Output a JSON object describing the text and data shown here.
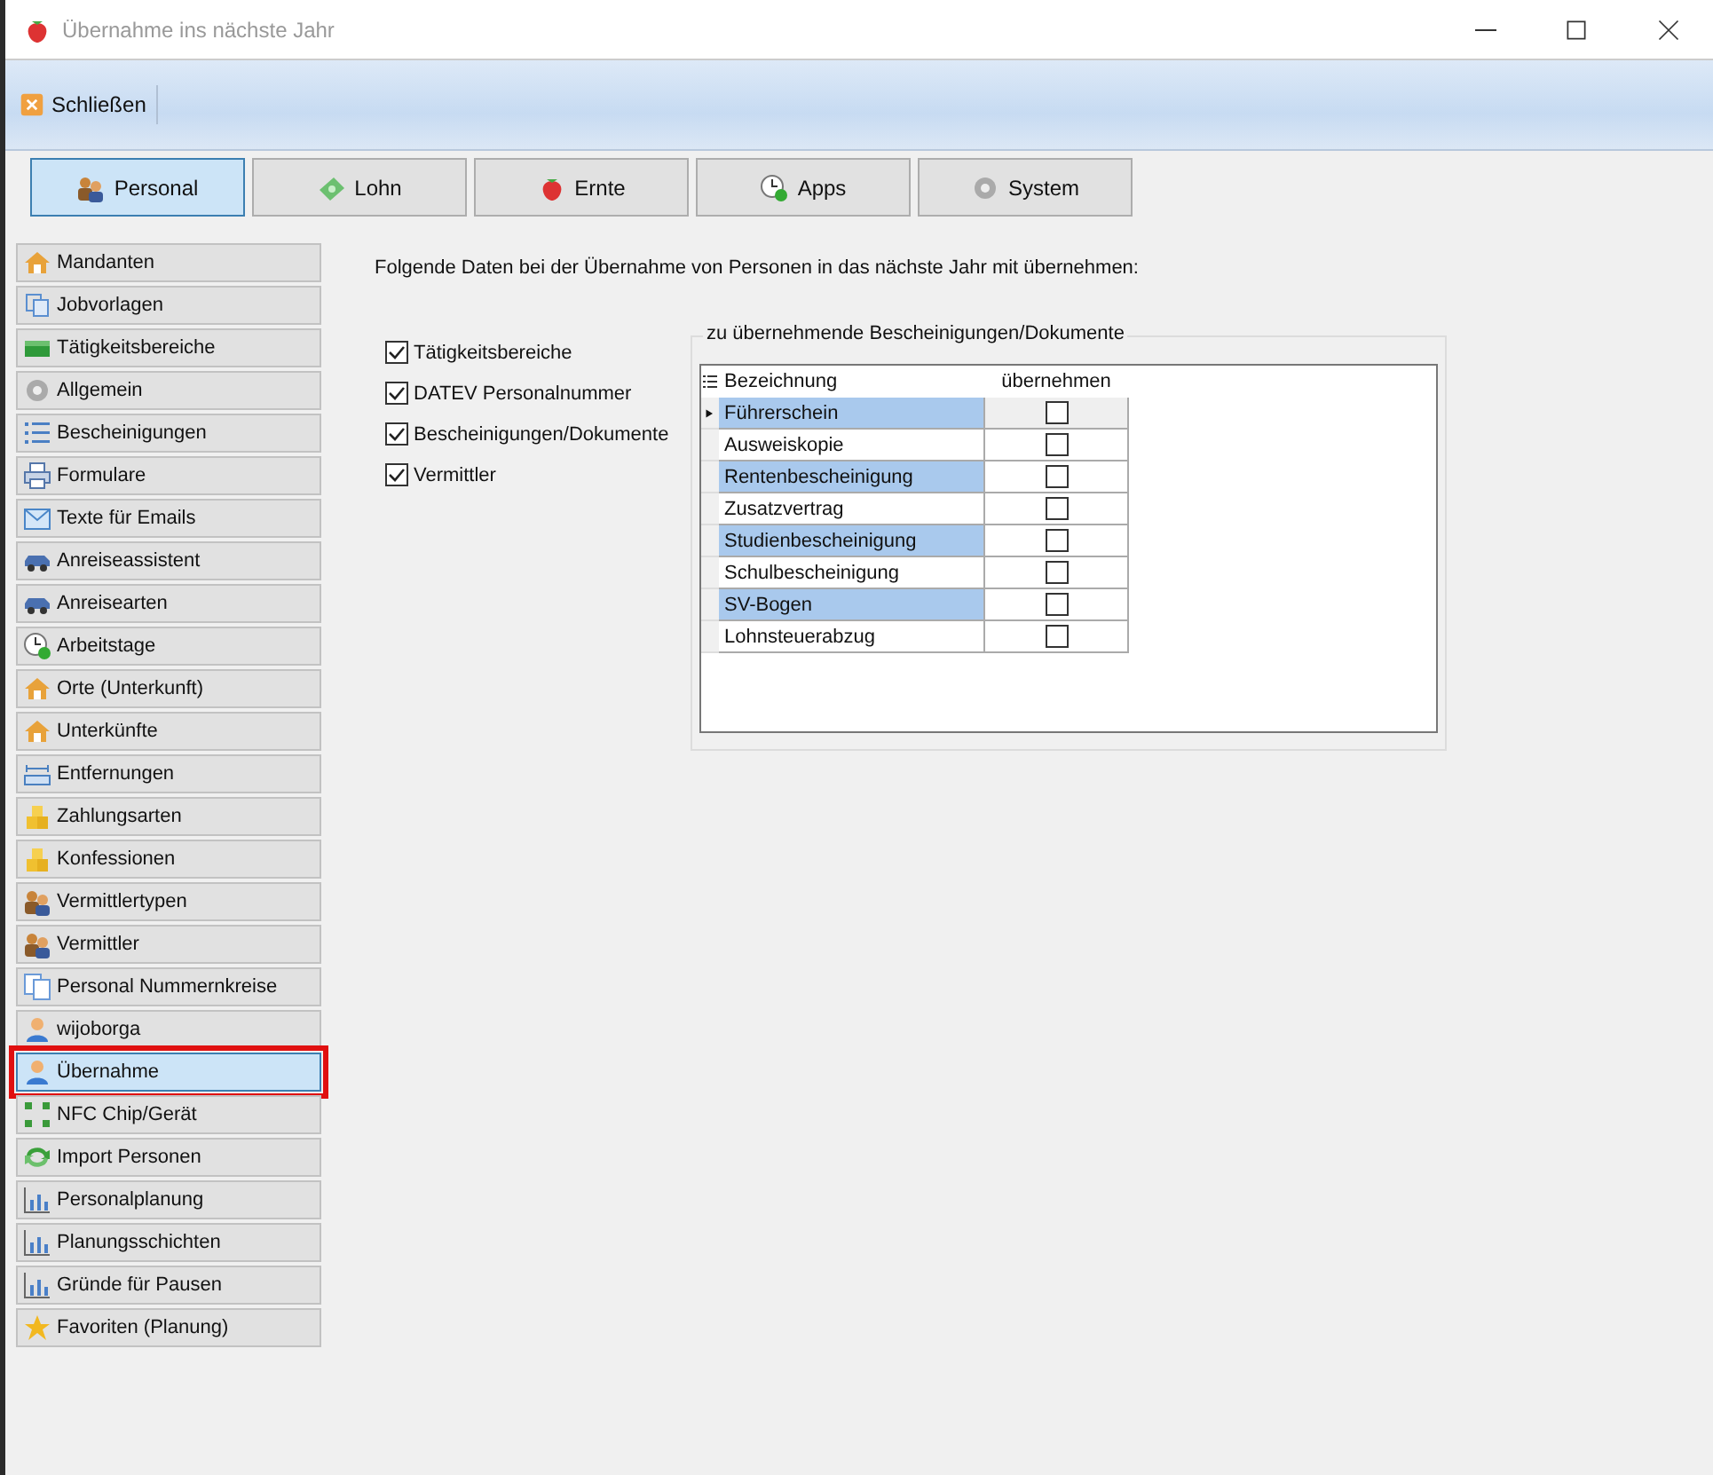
{
  "window": {
    "title": "Übernahme ins nächste Jahr"
  },
  "toolbar": {
    "buttons": [
      {
        "label": "Schließen"
      }
    ]
  },
  "tabs": [
    {
      "label": "Personal",
      "selected": true
    },
    {
      "label": "Lohn",
      "selected": false
    },
    {
      "label": "Ernte",
      "selected": false
    },
    {
      "label": "Apps",
      "selected": false
    },
    {
      "label": "System",
      "selected": false
    }
  ],
  "sidebar": {
    "items": [
      {
        "label": "Mandanten",
        "selected": false,
        "highlighted": false
      },
      {
        "label": "Jobvorlagen",
        "selected": false,
        "highlighted": false
      },
      {
        "label": "Tätigkeitsbereiche",
        "selected": false,
        "highlighted": false
      },
      {
        "label": "Allgemein",
        "selected": false,
        "highlighted": false
      },
      {
        "label": "Bescheinigungen",
        "selected": false,
        "highlighted": false
      },
      {
        "label": "Formulare",
        "selected": false,
        "highlighted": false
      },
      {
        "label": "Texte für Emails",
        "selected": false,
        "highlighted": false
      },
      {
        "label": "Anreiseassistent",
        "selected": false,
        "highlighted": false
      },
      {
        "label": "Anreisearten",
        "selected": false,
        "highlighted": false
      },
      {
        "label": "Arbeitstage",
        "selected": false,
        "highlighted": false
      },
      {
        "label": "Orte (Unterkunft)",
        "selected": false,
        "highlighted": false
      },
      {
        "label": "Unterkünfte",
        "selected": false,
        "highlighted": false
      },
      {
        "label": "Entfernungen",
        "selected": false,
        "highlighted": false
      },
      {
        "label": "Zahlungsarten",
        "selected": false,
        "highlighted": false
      },
      {
        "label": "Konfessionen",
        "selected": false,
        "highlighted": false
      },
      {
        "label": "Vermittlertypen",
        "selected": false,
        "highlighted": false
      },
      {
        "label": "Vermittler",
        "selected": false,
        "highlighted": false
      },
      {
        "label": "Personal Nummernkreise",
        "selected": false,
        "highlighted": false
      },
      {
        "label": "wijoborga",
        "selected": false,
        "highlighted": false
      },
      {
        "label": "Übernahme",
        "selected": true,
        "highlighted": true
      },
      {
        "label": "NFC Chip/Gerät",
        "selected": false,
        "highlighted": false
      },
      {
        "label": "Import Personen",
        "selected": false,
        "highlighted": false
      },
      {
        "label": "Personalplanung",
        "selected": false,
        "highlighted": false
      },
      {
        "label": "Planungsschichten",
        "selected": false,
        "highlighted": false
      },
      {
        "label": "Gründe für Pausen",
        "selected": false,
        "highlighted": false
      },
      {
        "label": "Favoriten (Planung)",
        "selected": false,
        "highlighted": false
      }
    ]
  },
  "content": {
    "intro": "Folgende Daten bei der Übernahme von Personen in das nächste Jahr mit übernehmen:",
    "options": [
      {
        "label": "Tätigkeitsbereiche",
        "checked": true
      },
      {
        "label": "DATEV Personalnummer",
        "checked": true
      },
      {
        "label": "Bescheinigungen/Dokumente",
        "checked": true
      },
      {
        "label": "Vermittler",
        "checked": true
      }
    ],
    "documents": {
      "title": "zu übernehmende Bescheinigungen/Dokumente",
      "columns": [
        "Bezeichnung",
        "übernehmen"
      ],
      "rows": [
        {
          "name": "Führerschein",
          "checked": false,
          "current": true
        },
        {
          "name": "Ausweiskopie",
          "checked": false,
          "current": false
        },
        {
          "name": "Rentenbescheinigung",
          "checked": false,
          "current": false
        },
        {
          "name": "Zusatzvertrag",
          "checked": false,
          "current": false
        },
        {
          "name": "Studienbescheinigung",
          "checked": false,
          "current": false
        },
        {
          "name": "Schulbescheinigung",
          "checked": false,
          "current": false
        },
        {
          "name": "SV-Bogen",
          "checked": false,
          "current": false
        },
        {
          "name": "Lohnsteuerabzug",
          "checked": false,
          "current": false
        }
      ]
    }
  }
}
